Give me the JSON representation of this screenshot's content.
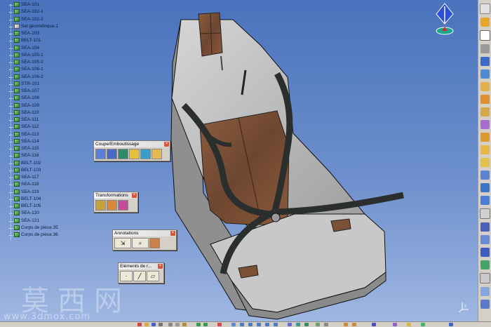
{
  "tree": {
    "items": [
      {
        "label": "SEA-101",
        "kind": "part"
      },
      {
        "label": "SEA-102-1",
        "kind": "part"
      },
      {
        "label": "SEA-102-2",
        "kind": "part"
      },
      {
        "label": "Set géométrique.1",
        "kind": "geom"
      },
      {
        "label": "SEA-103",
        "kind": "part"
      },
      {
        "label": "BELT-101",
        "kind": "part"
      },
      {
        "label": "SEA-104",
        "kind": "part"
      },
      {
        "label": "SEA-105-1",
        "kind": "part"
      },
      {
        "label": "SEA-105-2",
        "kind": "part"
      },
      {
        "label": "SEA-106-1",
        "kind": "part"
      },
      {
        "label": "SEA-106-2",
        "kind": "part"
      },
      {
        "label": "STR-101",
        "kind": "part"
      },
      {
        "label": "SEA-107",
        "kind": "part"
      },
      {
        "label": "SEA-108",
        "kind": "part"
      },
      {
        "label": "SEA-109",
        "kind": "part"
      },
      {
        "label": "SEA-110",
        "kind": "part"
      },
      {
        "label": "SEA-111",
        "kind": "part"
      },
      {
        "label": "SEA-112",
        "kind": "part"
      },
      {
        "label": "SEA-113",
        "kind": "part"
      },
      {
        "label": "SEA-114",
        "kind": "part"
      },
      {
        "label": "SEA-115",
        "kind": "part"
      },
      {
        "label": "SEA-116",
        "kind": "part"
      },
      {
        "label": "BELT-102",
        "kind": "part"
      },
      {
        "label": "BELT-103",
        "kind": "part"
      },
      {
        "label": "SEA-117",
        "kind": "part"
      },
      {
        "label": "SEA-118",
        "kind": "part"
      },
      {
        "label": "SEA-119",
        "kind": "part"
      },
      {
        "label": "BELT-104",
        "kind": "part"
      },
      {
        "label": "BELT-105",
        "kind": "part"
      },
      {
        "label": "SEA-120",
        "kind": "part"
      },
      {
        "label": "SEA-121",
        "kind": "part"
      },
      {
        "label": "Corps de pièce.35",
        "kind": "part"
      },
      {
        "label": "Corps de pièce.36",
        "kind": "part"
      }
    ]
  },
  "toolbars": {
    "coupe": {
      "title": "Coupe/Emboutissage",
      "close": "×"
    },
    "transformations": {
      "title": "Transformations",
      "close": "×"
    },
    "annotations": {
      "title": "Annotations",
      "close": "×"
    },
    "elements": {
      "title": "Eléments de r...",
      "close": "×"
    }
  },
  "watermark": {
    "text": "莫西网",
    "url": "www.3dmox.com"
  },
  "colors": {
    "viewport_top": "#4a73bd",
    "viewport_bottom": "#9fb7e2",
    "toolbar_bg": "#d4d0c8",
    "seat_shell": "#c2c2c2",
    "cushion": "#7a5035",
    "belt": "#2a2e2c"
  },
  "icons": {
    "compass": "compass-icon",
    "axis": "axis-triad-icon"
  }
}
